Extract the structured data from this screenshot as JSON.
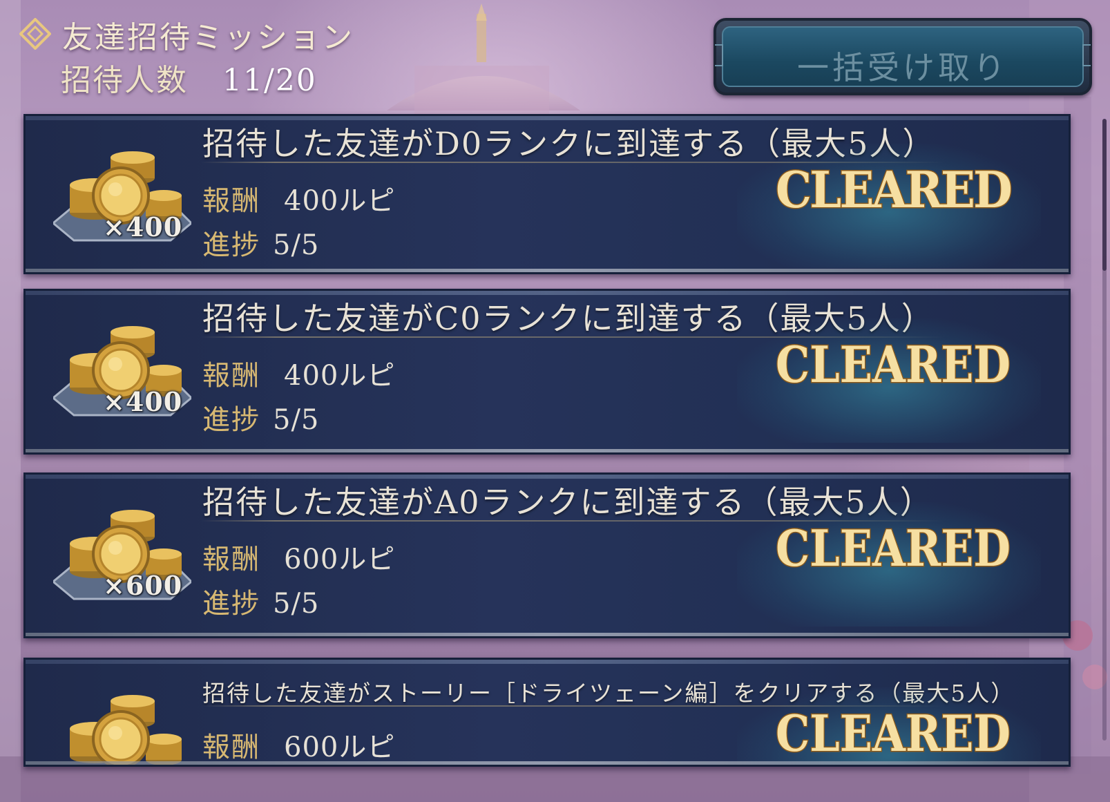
{
  "header": {
    "title": "友達招待ミッション",
    "invite_label": "招待人数",
    "invite_count": "11/20",
    "title_icon": "diamond-icon"
  },
  "bulk_receive_button": {
    "label": "一括受け取り",
    "enabled": false
  },
  "missions": [
    {
      "title": "招待した友達がD0ランクに到達する（最大5人）",
      "reward_label": "報酬",
      "reward_value": "400ルピ",
      "progress_label": "進捗",
      "progress_value": "5/5",
      "item_quantity": "×400",
      "item_icon": "gold-coins-icon",
      "status": "CLEARED"
    },
    {
      "title": "招待した友達がC0ランクに到達する（最大5人）",
      "reward_label": "報酬",
      "reward_value": "400ルピ",
      "progress_label": "進捗",
      "progress_value": "5/5",
      "item_quantity": "×400",
      "item_icon": "gold-coins-icon",
      "status": "CLEARED"
    },
    {
      "title": "招待した友達がA0ランクに到達する（最大5人）",
      "reward_label": "報酬",
      "reward_value": "600ルピ",
      "progress_label": "進捗",
      "progress_value": "5/5",
      "item_quantity": "×600",
      "item_icon": "gold-coins-icon",
      "status": "CLEARED"
    },
    {
      "title": "招待した友達がストーリー［ドライツェーン編］をクリアする（最大5人）",
      "reward_label": "報酬",
      "reward_value": "600ルピ",
      "item_icon": "gold-coins-icon",
      "status": "CLEARED"
    }
  ],
  "colors": {
    "card_background": "#26335a",
    "label_gold": "#d7b872",
    "cleared_gold": "#f3d796",
    "button_teal": "#1b4860"
  }
}
